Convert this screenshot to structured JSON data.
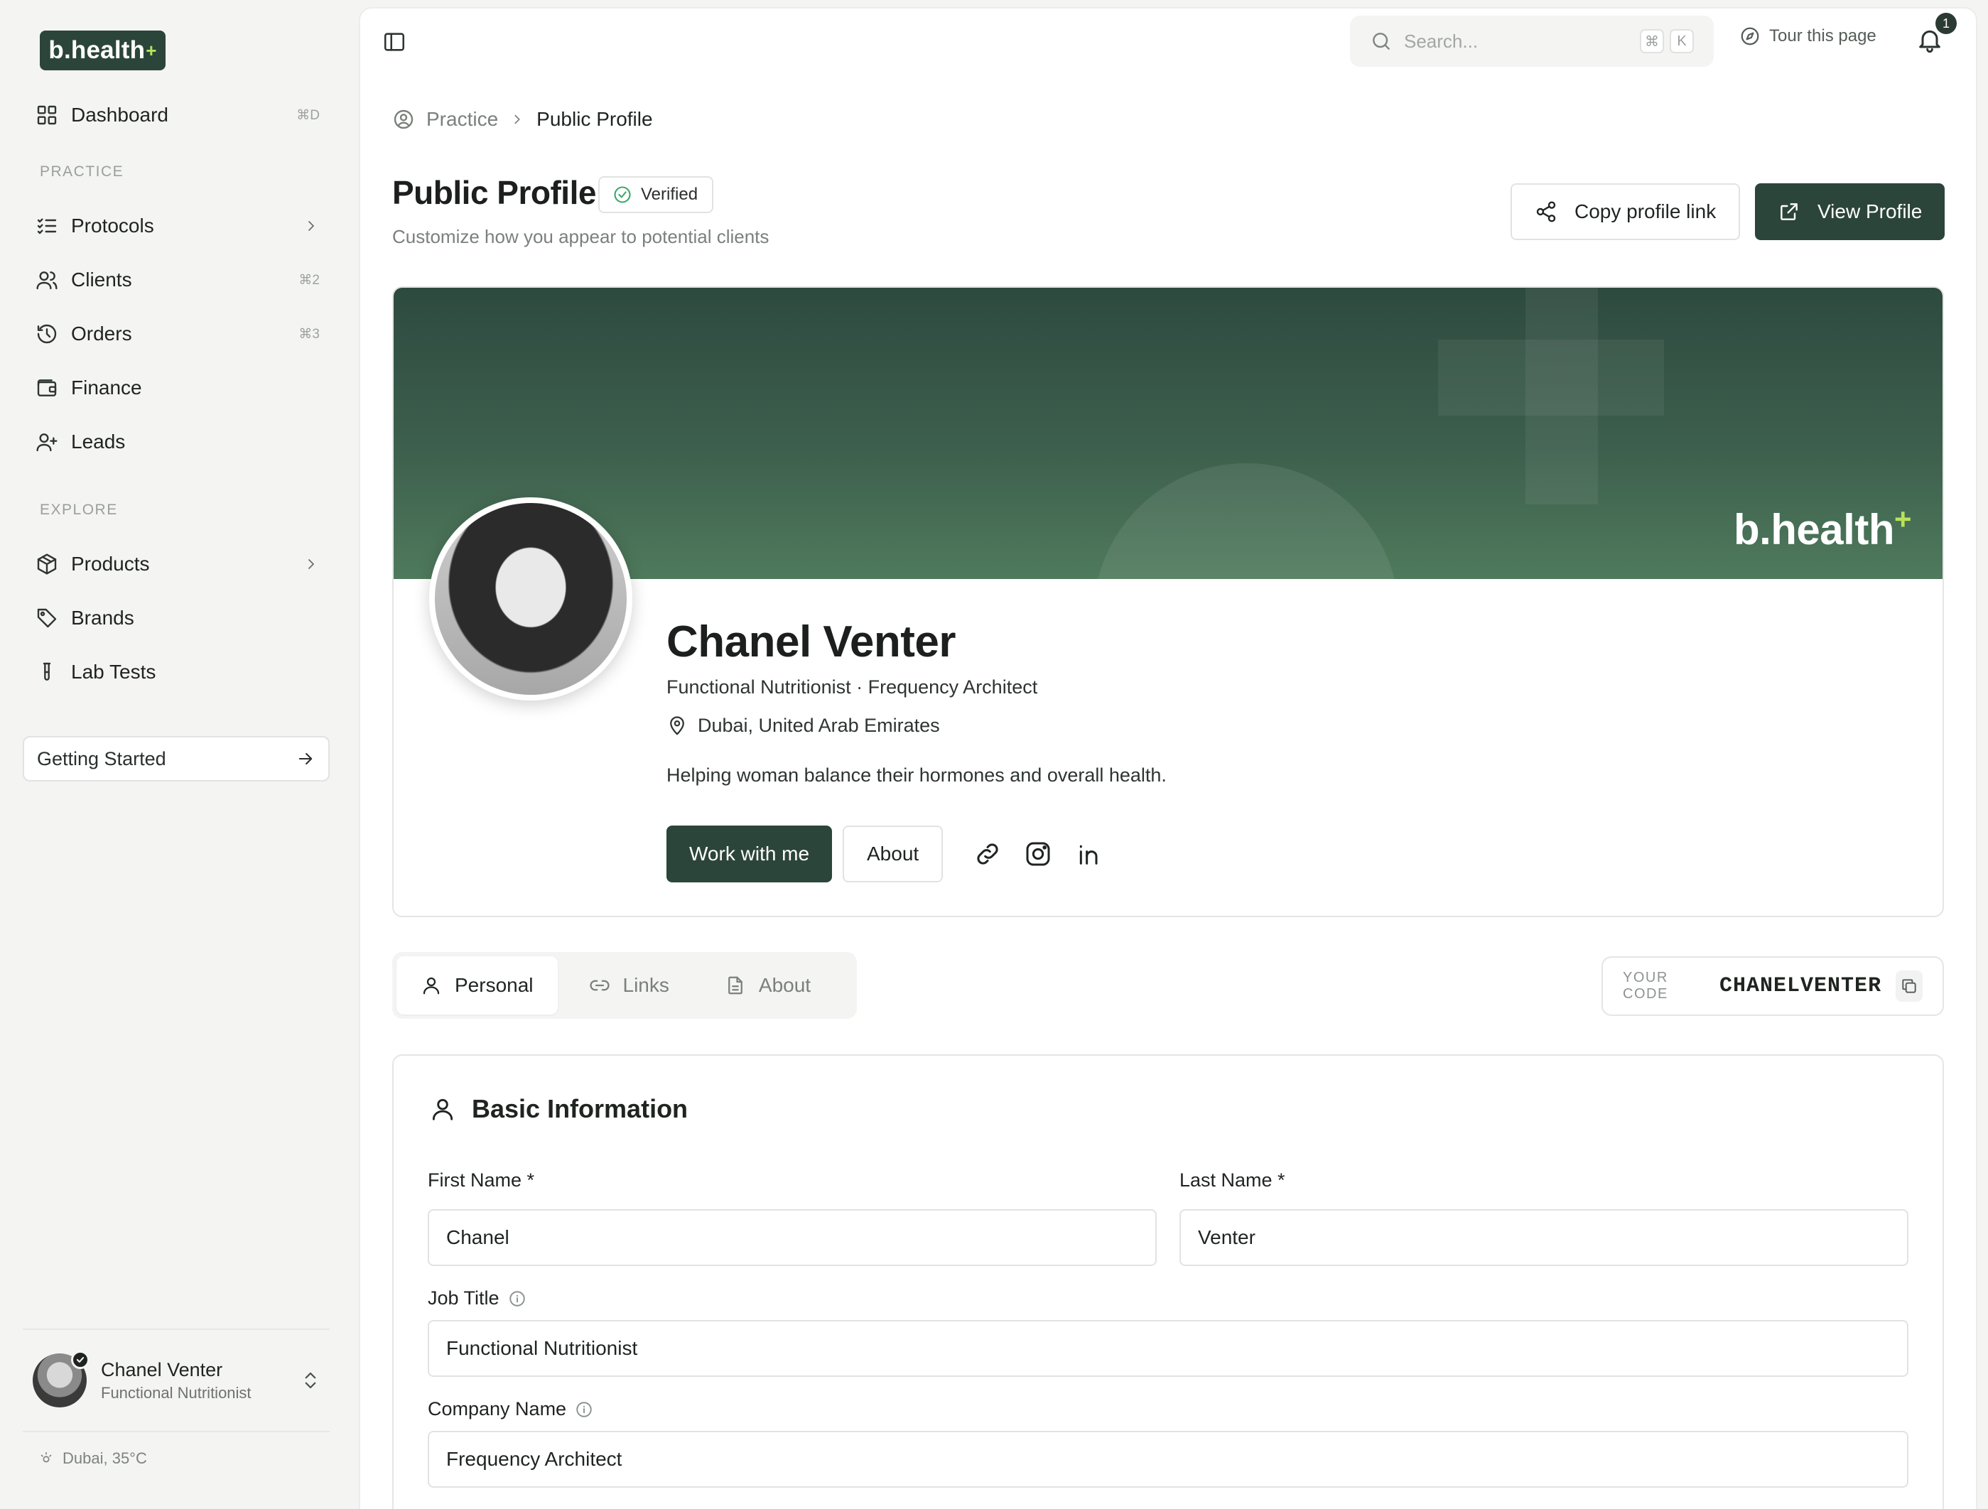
{
  "brand": {
    "name": "b.health",
    "mark": "+",
    "accent": "#b7e35b",
    "primary": "#2c453a"
  },
  "sidebar": {
    "dashboard": {
      "label": "Dashboard",
      "shortcut": "⌘D"
    },
    "practice_header": "PRACTICE",
    "practice_items": [
      {
        "label": "Protocols",
        "icon": "list-check-icon",
        "chevron": true
      },
      {
        "label": "Clients",
        "icon": "users-icon",
        "shortcut": "⌘2"
      },
      {
        "label": "Orders",
        "icon": "history-icon",
        "shortcut": "⌘3"
      },
      {
        "label": "Finance",
        "icon": "wallet-icon"
      },
      {
        "label": "Leads",
        "icon": "user-plus-icon"
      }
    ],
    "explore_header": "EXPLORE",
    "explore_items": [
      {
        "label": "Products",
        "icon": "box-icon",
        "chevron": true
      },
      {
        "label": "Brands",
        "icon": "tag-icon"
      },
      {
        "label": "Lab Tests",
        "icon": "test-tube-icon"
      }
    ],
    "getting_started": "Getting Started",
    "user": {
      "name": "Chanel Venter",
      "role": "Functional Nutritionist"
    },
    "weather": "Dubai, 35°C"
  },
  "topbar": {
    "search_placeholder": "Search...",
    "kbd1": "⌘",
    "kbd2": "K",
    "tour": "Tour this page",
    "notifications": "1"
  },
  "breadcrumb": {
    "parent": "Practice",
    "current": "Public Profile"
  },
  "header": {
    "title": "Public Profile",
    "verified": "Verified",
    "subtitle": "Customize how you appear to potential clients",
    "copy_link": "Copy profile link",
    "view_profile": "View Profile"
  },
  "profile": {
    "banner_brand": "b.health",
    "name": "Chanel Venter",
    "role_line": "Functional Nutritionist · Frequency Architect",
    "location": "Dubai, United Arab Emirates",
    "bio": "Helping woman balance their hormones and overall health.",
    "cta": "Work with me",
    "about": "About",
    "socials": [
      "link-icon",
      "instagram-icon",
      "linkedin-icon"
    ]
  },
  "tabs": [
    {
      "label": "Personal"
    },
    {
      "label": "Links"
    },
    {
      "label": "About"
    }
  ],
  "code": {
    "label": "YOUR CODE",
    "value": "CHANELVENTER"
  },
  "form": {
    "title": "Basic Information",
    "first_name_label": "First Name *",
    "first_name": "Chanel",
    "last_name_label": "Last Name *",
    "last_name": "Venter",
    "job_title_label": "Job Title",
    "job_title": "Functional Nutritionist",
    "company_label": "Company Name",
    "company": "Frequency Architect"
  }
}
